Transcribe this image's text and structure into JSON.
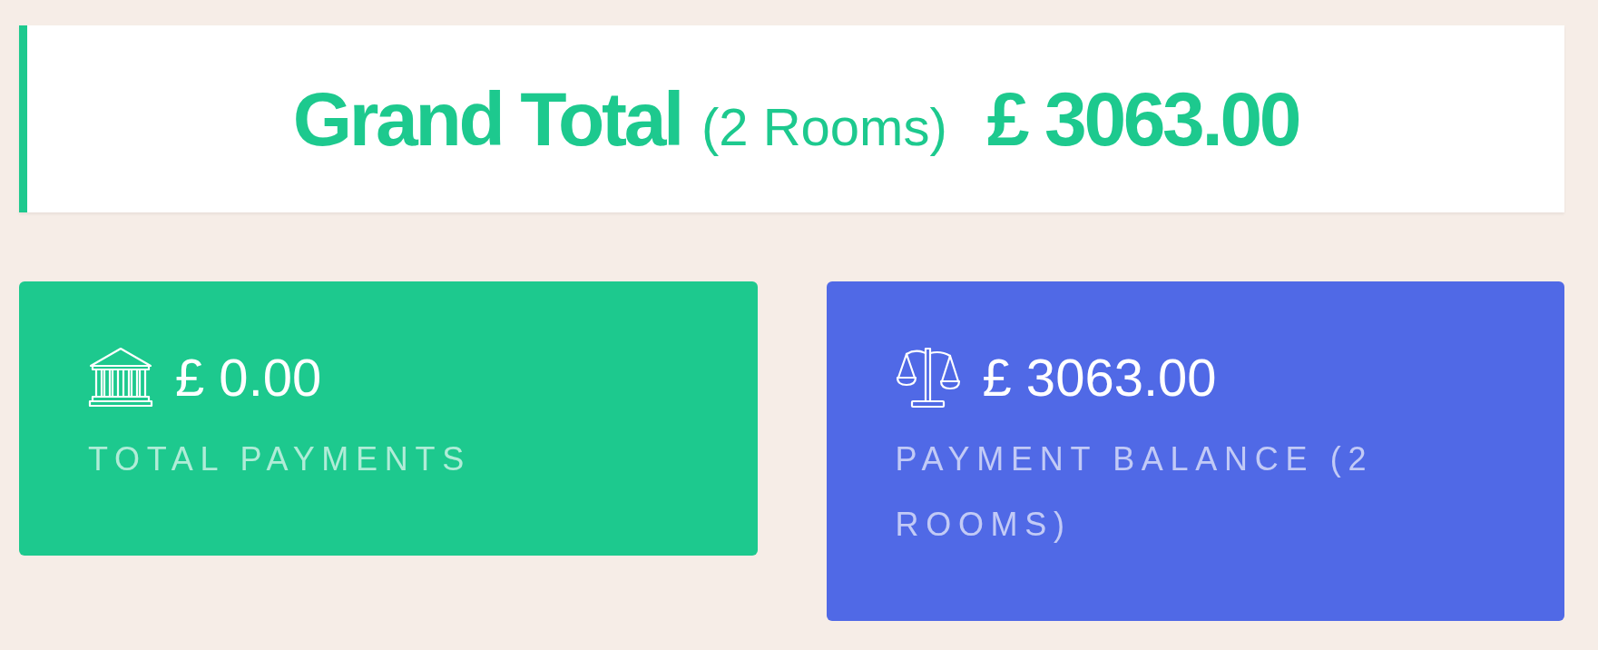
{
  "grand_total": {
    "label": "Grand Total",
    "rooms": "(2 Rooms)",
    "amount": "£ 3063.00"
  },
  "summary_cards": [
    {
      "kind": "payments",
      "color": "#1dc98e",
      "amount": "£ 0.00",
      "label": "TOTAL PAYMENTS"
    },
    {
      "kind": "balance",
      "color": "#5069e6",
      "amount": "£ 3063.00",
      "label": "PAYMENT BALANCE (2 ROOMS)"
    }
  ]
}
